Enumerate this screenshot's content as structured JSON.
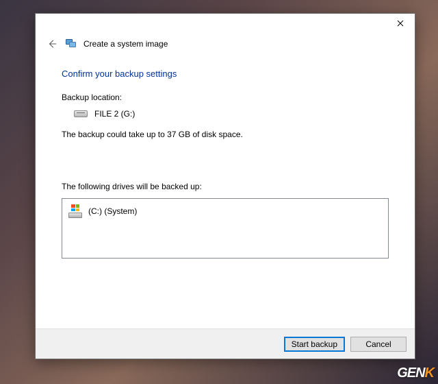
{
  "window": {
    "title": "Create a system image"
  },
  "heading": "Confirm your backup settings",
  "backup_location_label": "Backup location:",
  "backup_location_value": "FILE 2 (G:)",
  "space_info": "The backup could take up to 37 GB of disk space.",
  "drives_label": "The following drives will be backed up:",
  "drives": [
    {
      "label": "(C:) (System)"
    }
  ],
  "buttons": {
    "start": "Start backup",
    "cancel": "Cancel"
  },
  "watermark": {
    "part1": "GEN",
    "part2": "K"
  }
}
